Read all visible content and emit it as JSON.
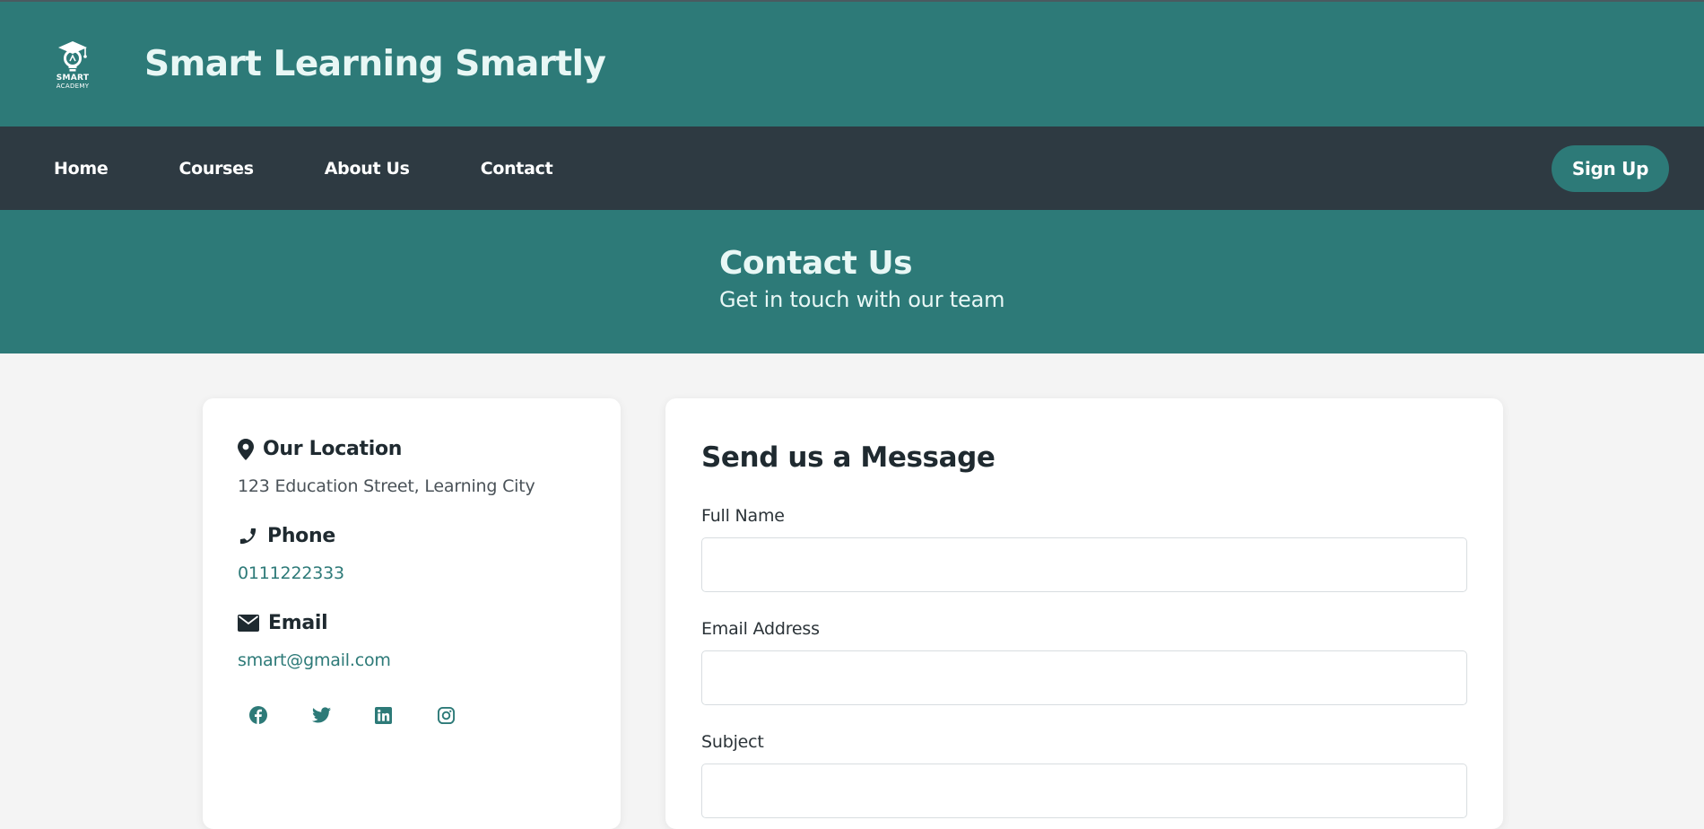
{
  "header": {
    "logo_line1": "SMART",
    "logo_line2": "ACADEMY",
    "site_title": "Smart Learning Smartly"
  },
  "nav": {
    "links": [
      "Home",
      "Courses",
      "About Us",
      "Contact"
    ],
    "signup_label": "Sign Up"
  },
  "hero": {
    "title": "Contact Us",
    "subtitle": "Get in touch with our team"
  },
  "contact_info": {
    "location": {
      "title": "Our Location",
      "value": "123 Education Street, Learning City",
      "icon": "map-pin-icon"
    },
    "phone": {
      "title": "Phone",
      "value": "0111222333",
      "icon": "phone-icon"
    },
    "email": {
      "title": "Email",
      "value": "smart@gmail.com",
      "icon": "envelope-icon"
    },
    "socials": [
      "facebook-icon",
      "twitter-icon",
      "linkedin-icon",
      "instagram-icon"
    ]
  },
  "form": {
    "title": "Send us a Message",
    "fields": [
      {
        "label": "Full Name",
        "value": "",
        "placeholder": ""
      },
      {
        "label": "Email Address",
        "value": "",
        "placeholder": ""
      },
      {
        "label": "Subject",
        "value": "",
        "placeholder": ""
      }
    ]
  },
  "colors": {
    "primary": "#2d7a78",
    "nav_bg": "#2e3a42",
    "page_bg": "#f4f4f4",
    "heading_text": "#e8f7f5"
  }
}
